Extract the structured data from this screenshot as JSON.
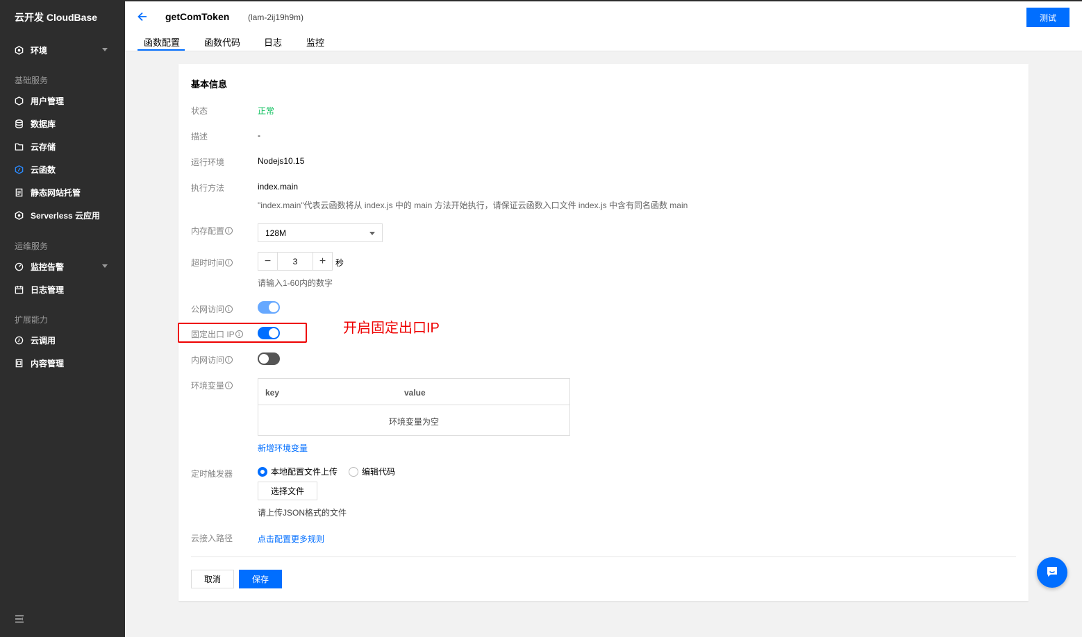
{
  "sidebar": {
    "brand": "云开发 CloudBase",
    "env_label": "环境",
    "sections": {
      "basic": "基础服务",
      "ops": "运维服务",
      "ext": "扩展能力"
    },
    "items": {
      "users": "用户管理",
      "database": "数据库",
      "storage": "云存储",
      "functions": "云函数",
      "hosting": "静态网站托管",
      "serverless": "Serverless 云应用",
      "monitor": "监控告警",
      "logs": "日志管理",
      "callcloud": "云调用",
      "cms": "内容管理"
    }
  },
  "header": {
    "function_name": "getComToken",
    "function_id": "(lam-2ij19h9m)",
    "test_button": "测试",
    "tabs": [
      "函数配置",
      "函数代码",
      "日志",
      "监控"
    ]
  },
  "basic_info": {
    "title": "基本信息",
    "status_label": "状态",
    "status_value": "正常",
    "desc_label": "描述",
    "desc_value": "-",
    "runtime_label": "运行环境",
    "runtime_value": "Nodejs10.15",
    "handler_label": "执行方法",
    "handler_value": "index.main",
    "handler_hint": "\"index.main\"代表云函数将从 index.js 中的 main 方法开始执行，请保证云函数入口文件 index.js 中含有同名函数 main",
    "memory_label": "内存配置",
    "memory_value": "128M",
    "timeout_label": "超时时间",
    "timeout_value": "3",
    "timeout_minus": "−",
    "timeout_plus": "+",
    "timeout_unit": "秒",
    "timeout_hint": "请输入1-60内的数字",
    "public_access_label": "公网访问",
    "public_access_on": true,
    "fixed_ip_label": "固定出口 IP",
    "fixed_ip_on": true,
    "private_access_label": "内网访问",
    "private_access_on": false,
    "env_vars_label": "环境变量",
    "env_table": {
      "col_key": "key",
      "col_value": "value",
      "empty_text": "环境变量为空"
    },
    "add_env_var": "新增环境变量",
    "trigger_label": "定时触发器",
    "trigger_option_local": "本地配置文件上传",
    "trigger_option_edit": "编辑代码",
    "select_file_button": "选择文件",
    "upload_hint": "请上传JSON格式的文件",
    "cloud_access_label": "云接入路径",
    "cloud_access_link": "点击配置更多规则"
  },
  "annotation": {
    "text": "开启固定出口IP",
    "color": "#ee0000"
  },
  "footer": {
    "cancel": "取消",
    "save": "保存"
  },
  "colors": {
    "primary": "#006eff",
    "success": "#0abf5b",
    "sidebar_bg": "#2d2d2d"
  }
}
